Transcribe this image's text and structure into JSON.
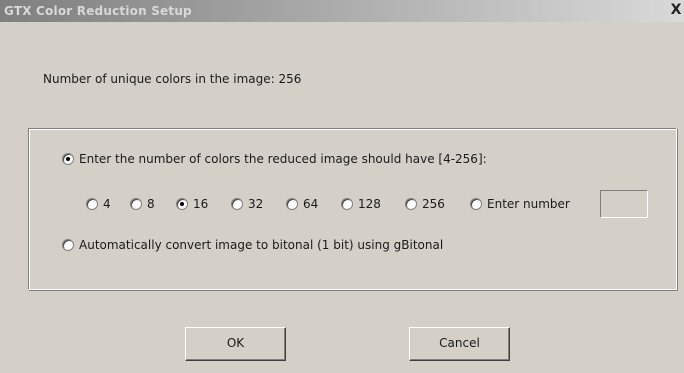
{
  "window": {
    "title": "GTX Color Reduction Setup",
    "close_glyph": "X"
  },
  "info": {
    "unique_colors": "Number of unique colors in the image: 256"
  },
  "options": {
    "enter_colors": {
      "label": "Enter the number of colors the reduced image should have [4-256]:",
      "checked": true
    },
    "bitonal": {
      "label": "Automatically convert image to bitonal (1 bit) using gBitonal",
      "checked": false
    }
  },
  "color_choices": [
    {
      "label": "4",
      "checked": false
    },
    {
      "label": "8",
      "checked": false
    },
    {
      "label": "16",
      "checked": true
    },
    {
      "label": "32",
      "checked": false
    },
    {
      "label": "64",
      "checked": false
    },
    {
      "label": "128",
      "checked": false
    },
    {
      "label": "256",
      "checked": false
    },
    {
      "label": "Enter number",
      "checked": false
    }
  ],
  "number_field": {
    "value": ""
  },
  "buttons": {
    "ok": "OK",
    "cancel": "Cancel"
  }
}
